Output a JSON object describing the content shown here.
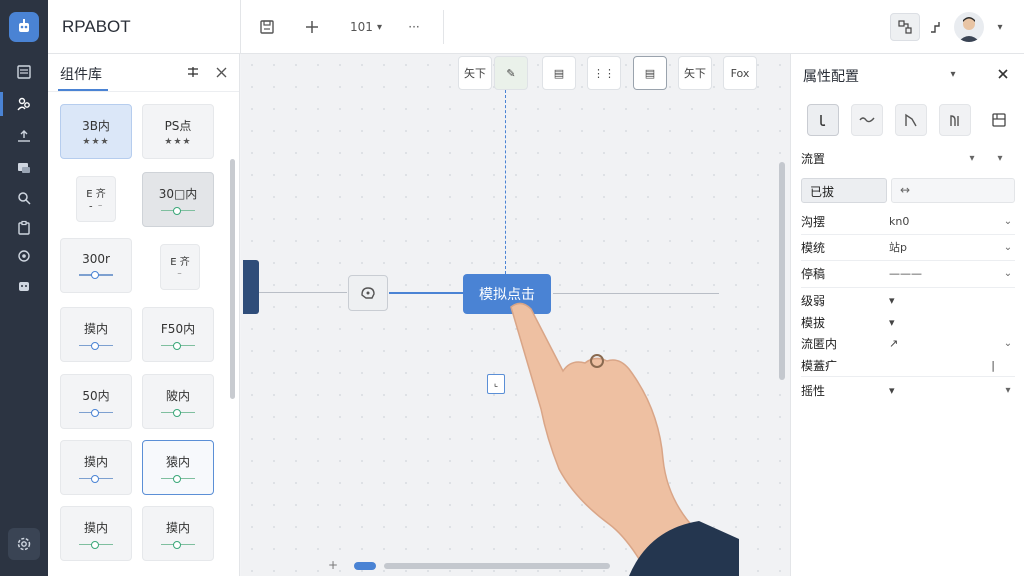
{
  "app": {
    "title": "RPABOT"
  },
  "header": {
    "more_label": "···",
    "zoom_label": "101",
    "zoom_chevron": "▾",
    "account_chevron": "▾"
  },
  "left_panel": {
    "title": "组件库",
    "cards": [
      {
        "label": "3B内",
        "sub": "★★★"
      },
      {
        "label": "PS点",
        "sub": "★★★"
      },
      {
        "label": "E 齐",
        "sub": "⁃ ⁻"
      },
      {
        "label": "30□内"
      },
      {
        "label": "300r",
        "sub": "★"
      },
      {
        "label": "E 齐",
        "sub": "⁻"
      },
      {
        "label": "摸内"
      },
      {
        "label": "F50内"
      },
      {
        "label": "50内"
      },
      {
        "label": "陂内"
      },
      {
        "label": "摸内"
      },
      {
        "label": "猿内"
      },
      {
        "label": "摸内"
      },
      {
        "label": "摸内"
      }
    ]
  },
  "canvas": {
    "toolbar": [
      "矢下",
      "✎",
      "▤",
      "⋮⋮",
      "▤",
      "矢下",
      "Fox"
    ],
    "main_node_label": "模拟点击",
    "port_label": "⌞"
  },
  "right_panel": {
    "title": "属性配置",
    "section_label": "流置",
    "tabs": [
      "已拔",
      "↔"
    ],
    "rows": [
      {
        "label": "沟摆",
        "value": "kn0"
      },
      {
        "label": "模统",
        "value": "站p"
      },
      {
        "label": "停稿",
        "value": "———"
      },
      {
        "label": "级弱",
        "value": "▾"
      },
      {
        "label": "模拔",
        "value": "▾"
      },
      {
        "label": "流匿内",
        "value": "↗"
      },
      {
        "label": "模蓋疒",
        "value": "|"
      },
      {
        "label": "摇性",
        "value": "▾"
      }
    ]
  },
  "colors": {
    "accent": "#4a83d4",
    "rail": "#2c3442",
    "node_start": "#2f4d79"
  }
}
